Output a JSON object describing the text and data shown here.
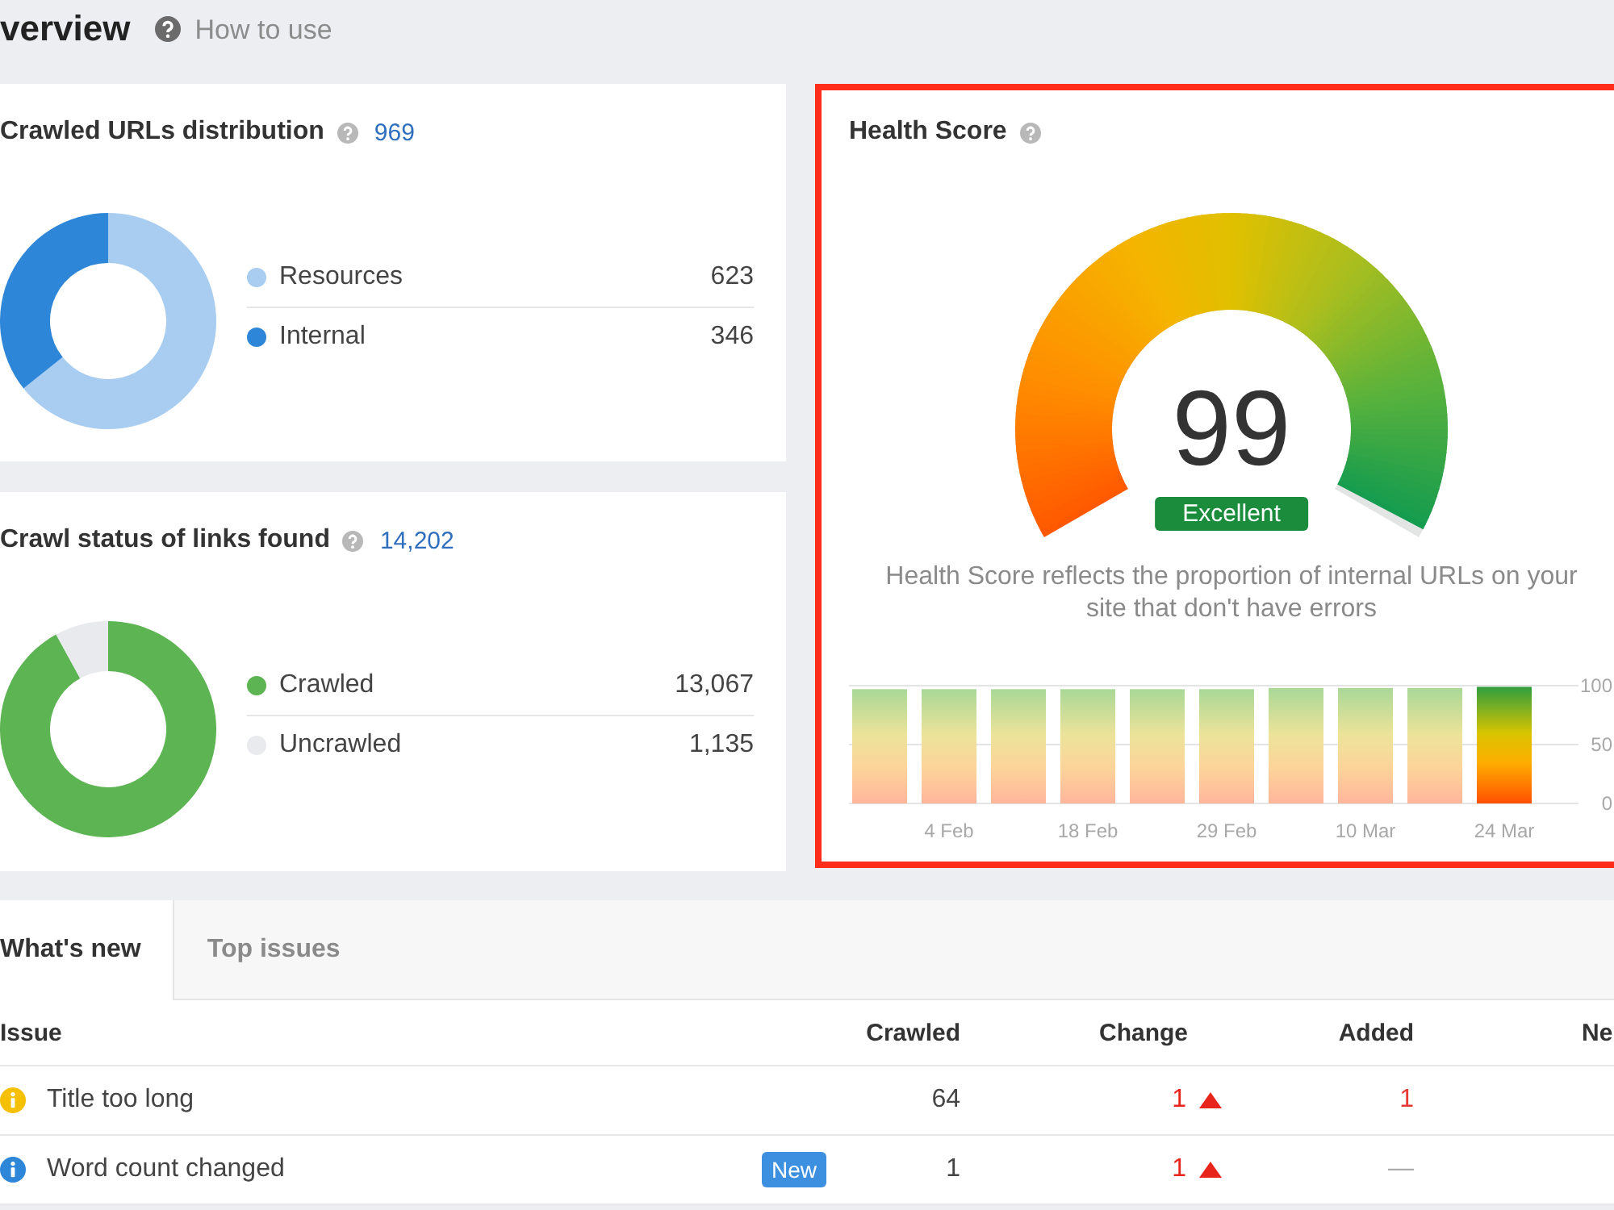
{
  "header": {
    "title": "verview",
    "help_link": "How to use"
  },
  "crawled_urls": {
    "title": "Crawled URLs distribution",
    "total": "969",
    "legend": [
      {
        "count": "623",
        "color": "#a8cdf1"
      },
      {
        "count": "346",
        "color": "#2e86d8"
      }
    ],
    "chart_data": {
      "type": "donut",
      "categories": [
        "Resources",
        "Internal"
      ],
      "values": [
        64.3,
        35.7
      ]
    }
  },
  "crawl_status": {
    "title": "Crawl status of links found",
    "total": "14,202",
    "legend": [
      {
        "count": "13,067",
        "color": "#5cb452"
      },
      {
        "count": "1,135",
        "color": "#e8eaed"
      }
    ],
    "chart_data": {
      "type": "donut",
      "categories": [
        "Crawled",
        "Uncrawled"
      ],
      "values": [
        92,
        8
      ]
    }
  },
  "health": {
    "title": "Health Score",
    "gauge": {
      "score": "99",
      "level": 0.99,
      "rating": "Excellent"
    },
    "description": "Health Score reflects the proportion of internal URLs on your site that don't have errors",
    "chart_data": {
      "type": "bar",
      "categories": [
        null,
        "4 Feb",
        null,
        "18 Feb",
        null,
        "29 Feb",
        null,
        "10 Mar",
        null,
        "24 Mar"
      ],
      "values": [
        97,
        97,
        97,
        97,
        97,
        97,
        98,
        98,
        98,
        99
      ],
      "ylim": [
        0,
        100
      ],
      "yticks": [
        0,
        50,
        100
      ]
    }
  },
  "issues": {
    "tabs": [
      {
        "label": "What's new",
        "selected": true
      },
      {
        "label": "Top issues",
        "selected": false
      }
    ],
    "columns": [
      "Issue",
      "Crawled",
      "Change",
      "Added",
      "Ne"
    ],
    "rows": [
      {
        "kind": "warning",
        "issue": "Title too long",
        "crawled": "64",
        "change": "1",
        "change_rising": true,
        "added": "1",
        "added_changed": true
      },
      {
        "kind": "info",
        "issue": "Word count changed",
        "badge": "New",
        "crawled": "1",
        "change": "1",
        "change_rising": true,
        "added": "—",
        "added_changed": false
      }
    ]
  }
}
